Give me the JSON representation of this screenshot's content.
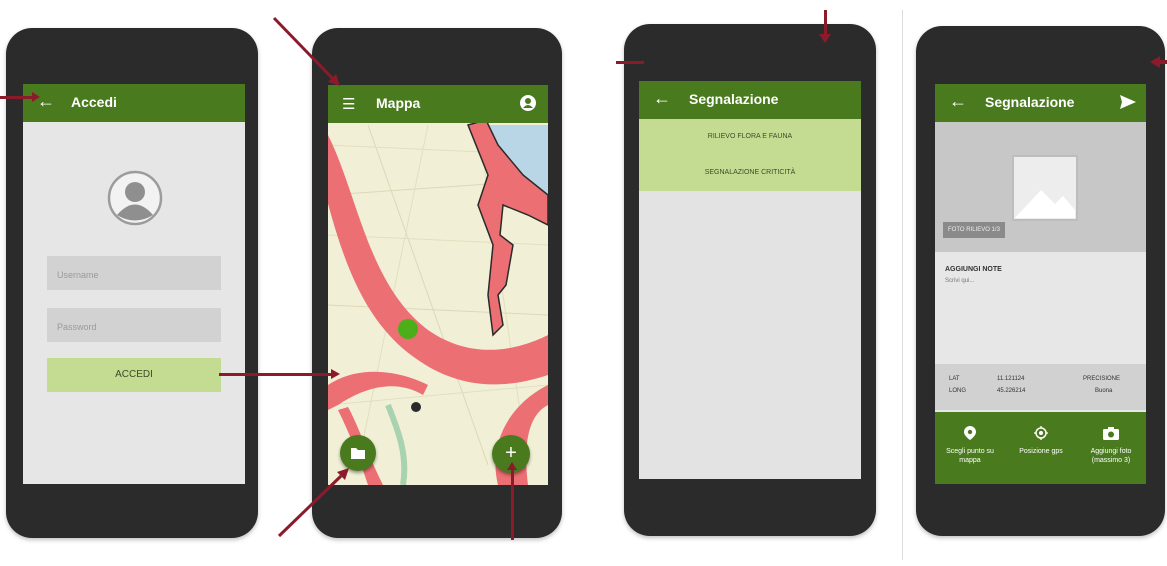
{
  "screens": {
    "login": {
      "title": "Accedi",
      "username_placeholder": "Username",
      "password_placeholder": "Password",
      "login_button": "ACCEDI"
    },
    "map": {
      "title": "Mappa"
    },
    "report_menu": {
      "title": "Segnalazione",
      "items": [
        "RILIEVO FLORA E FAUNA",
        "SEGNALAZIONE CRITICITÀ"
      ]
    },
    "report_form": {
      "title": "Segnalazione",
      "photo_label": "FOTO RILIEVO 1/3",
      "notes_label": "AGGIUNGI NOTE",
      "notes_value": "Scrivi qui...",
      "lat_label": "LAT",
      "lat_value": "11.121124",
      "long_label": "LONG",
      "long_value": "45.226214",
      "precision_label": "PRECISIONE",
      "precision_value": "Buona",
      "tools": [
        {
          "label": "Scegli punto su mappa",
          "icon": "pin-icon"
        },
        {
          "label": "Posizione gps",
          "icon": "gps-icon"
        },
        {
          "label": "Aggiungi foto (massimo 3)",
          "icon": "camera-icon"
        }
      ]
    }
  },
  "colors": {
    "primary": "#4a7a1e",
    "light_green": "#c4dc92",
    "arrow": "#8b1a2b",
    "phone": "#2b2b2b",
    "screen_bg": "#e4e4e4",
    "map_red": "#ec6f74",
    "map_land": "#f1f0d6"
  }
}
